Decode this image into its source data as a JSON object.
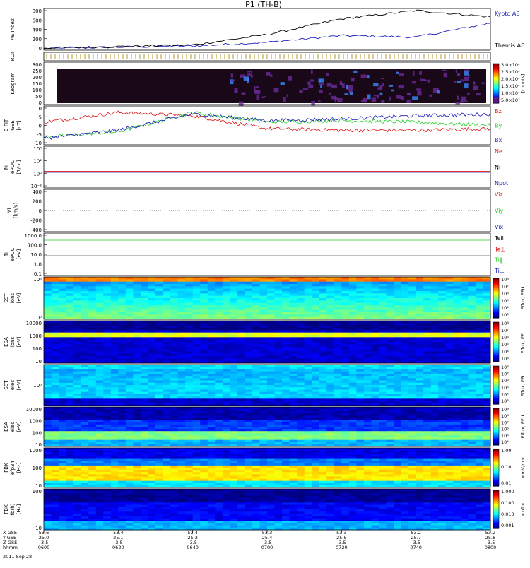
{
  "title": "P1 (TH-B)",
  "colors": {
    "blue": "#1a1ab8",
    "red": "#dd1111",
    "green": "#22cc22",
    "black": "#000000",
    "violet": "#2a0a4a"
  },
  "panels": [
    {
      "id": "ae",
      "ylabel": [
        "AE Index"
      ],
      "ticks": [
        "800",
        "600",
        "400",
        "200",
        "0"
      ],
      "legend": [
        {
          "text": "Kyoto AE",
          "color": "#1a1ab8"
        },
        {
          "text": "Themis AE",
          "color": "#000000"
        }
      ]
    },
    {
      "id": "roi",
      "ylabel": [
        "ROI"
      ],
      "ticks": [],
      "legend": []
    },
    {
      "id": "keogram",
      "ylabel": [
        "Keogram"
      ],
      "ticks": [
        "300",
        "250",
        "200",
        "150",
        "100",
        "50",
        "0"
      ],
      "legend": [],
      "colorbar": {
        "labels": [
          "3.0×10⁴",
          "2.5×10⁴",
          "2.0×10⁴",
          "1.5×10⁴",
          "1.0×10⁴",
          "5.0×10³"
        ],
        "title": "[counts]"
      }
    },
    {
      "id": "bfield",
      "ylabel": [
        "B FIT",
        "GSE",
        "[nT]"
      ],
      "ticks": [
        "10",
        "5",
        "0",
        "-5",
        "-10"
      ],
      "legend": [
        {
          "text": "Bz",
          "color": "#dd1111"
        },
        {
          "text": "By",
          "color": "#22cc22"
        },
        {
          "text": "Bx",
          "color": "#1a1ab8"
        }
      ]
    },
    {
      "id": "density",
      "ylabel": [
        "Ni",
        "ePOC",
        "[1/cc]"
      ],
      "ticks": [
        "10⁴",
        "10²",
        "10⁰",
        "10⁻²"
      ],
      "legend": [
        {
          "text": "Ne",
          "color": "#dd1111"
        },
        {
          "text": "Ni",
          "color": "#000000"
        },
        {
          "text": "Npot",
          "color": "#1a1ab8"
        }
      ]
    },
    {
      "id": "velocity",
      "ylabel": [
        "Vi",
        "[km/s]"
      ],
      "ticks": [
        "400",
        "200",
        "0",
        "-200",
        "-400"
      ],
      "legend": [
        {
          "text": "Viz",
          "color": "#dd1111"
        },
        {
          "text": "Viy",
          "color": "#22cc22"
        },
        {
          "text": "Vix",
          "color": "#1a1ab8"
        }
      ]
    },
    {
      "id": "temperature",
      "ylabel": [
        "Ti",
        "ePOC",
        "[eV]"
      ],
      "ticks": [
        "1000.0",
        "100.0",
        "10.0",
        "1.0",
        "0.1"
      ],
      "legend": [
        {
          "text": "Tell",
          "color": "#000000"
        },
        {
          "text": "Te⊥",
          "color": "#dd1111"
        },
        {
          "text": "Ti‖",
          "color": "#22cc22"
        },
        {
          "text": "Ti⊥",
          "color": "#1a1ab8"
        }
      ]
    },
    {
      "id": "sst_i",
      "ylabel": [
        "SST",
        "ions",
        "[eV]"
      ],
      "ticks": [
        "10⁶",
        "10⁵"
      ],
      "legend": [],
      "colorbar": {
        "labels": [
          "10⁸",
          "10⁷",
          "10⁶",
          "10⁵",
          "10⁴",
          "10³"
        ],
        "title": "Eflux, EFU"
      }
    },
    {
      "id": "esa_i",
      "ylabel": [
        "ESA",
        "ions",
        "[eV]"
      ],
      "ticks": [
        "10000",
        "1000",
        "100",
        "10"
      ],
      "legend": [],
      "colorbar": {
        "labels": [
          "10⁸",
          "10⁷",
          "10⁶",
          "10⁵",
          "10⁴",
          "10³"
        ],
        "title": "Eflux, EFU"
      }
    },
    {
      "id": "sst_e",
      "ylabel": [
        "SST",
        "elec",
        "[eV]"
      ],
      "ticks": [
        "10⁵"
      ],
      "legend": [],
      "colorbar": {
        "labels": [
          "10⁸",
          "10⁷",
          "10⁶",
          "10⁵",
          "10⁴",
          "10³"
        ],
        "title": "Eflux, EFU"
      }
    },
    {
      "id": "esa_e",
      "ylabel": [
        "ESA",
        "elec",
        "[eV]"
      ],
      "ticks": [
        "10000",
        "1000",
        "100",
        "10"
      ],
      "legend": [],
      "colorbar": {
        "labels": [
          "10⁹",
          "10⁸",
          "10⁷",
          "10⁶",
          "10⁵",
          "10⁴"
        ],
        "title": "Eflux, EFU"
      }
    },
    {
      "id": "fbk_e",
      "ylabel": [
        "FBK",
        "efp34",
        "[Hz]"
      ],
      "ticks": [
        "1000",
        "100",
        "10"
      ],
      "legend": [],
      "colorbar": {
        "labels": [
          "1.00",
          "0.10",
          "0.01"
        ],
        "title": "<mV/m>"
      }
    },
    {
      "id": "fbk_b",
      "ylabel": [
        "FBK",
        "fb(h)",
        "[Hz]"
      ],
      "ticks": [
        "100",
        "10"
      ],
      "legend": [],
      "colorbar": {
        "labels": [
          "1.000",
          "0.100",
          "0.010",
          "0.001"
        ],
        "title": "<nT>"
      }
    }
  ],
  "xaxis": {
    "row_labels": [
      "X-GSE",
      "Y-GSE",
      "Z-GSE",
      "hhmm",
      "2011 Sep 28"
    ],
    "columns": [
      {
        "vals": [
          "53.6",
          "25.0",
          "-3.5"
        ],
        "time": "0600"
      },
      {
        "vals": [
          "53.4",
          "25.1",
          "-3.5"
        ],
        "time": "0620"
      },
      {
        "vals": [
          "53.4",
          "25.2",
          "-3.5"
        ],
        "time": "0640"
      },
      {
        "vals": [
          "53.3",
          "25.4",
          "-3.5"
        ],
        "time": "0700"
      },
      {
        "vals": [
          "53.3",
          "25.5",
          "-3.5"
        ],
        "time": "0720"
      },
      {
        "vals": [
          "53.2",
          "25.7",
          "-3.5"
        ],
        "time": "0740"
      },
      {
        "vals": [
          "53.2",
          "25.8",
          "-3.5"
        ],
        "time": "0800"
      }
    ]
  },
  "chart_data": {
    "type": "line",
    "title": "P1 (TH-B)",
    "x": [
      "0600",
      "0620",
      "0640",
      "0700",
      "0720",
      "0740",
      "0800"
    ],
    "xlabel": "hhmm",
    "series": [
      {
        "name": "Kyoto AE",
        "panel": "AE Index",
        "values": [
          30,
          60,
          80,
          150,
          280,
          250,
          520
        ]
      },
      {
        "name": "Themis AE",
        "panel": "AE Index",
        "values": [
          40,
          70,
          100,
          300,
          600,
          760,
          640
        ]
      },
      {
        "name": "Bz",
        "panel": "B FIT GSE [nT]",
        "values": [
          2,
          8,
          6,
          -2,
          -3,
          -3,
          -2
        ]
      },
      {
        "name": "By",
        "panel": "B FIT GSE [nT]",
        "values": [
          -7,
          -4,
          8,
          2,
          3,
          2,
          0
        ]
      },
      {
        "name": "Bx",
        "panel": "B FIT GSE [nT]",
        "values": [
          -8,
          -3,
          7,
          3,
          4,
          6,
          7
        ]
      }
    ],
    "ylim_ae": [
      0,
      800
    ],
    "ylim_b": [
      -12,
      12
    ]
  }
}
